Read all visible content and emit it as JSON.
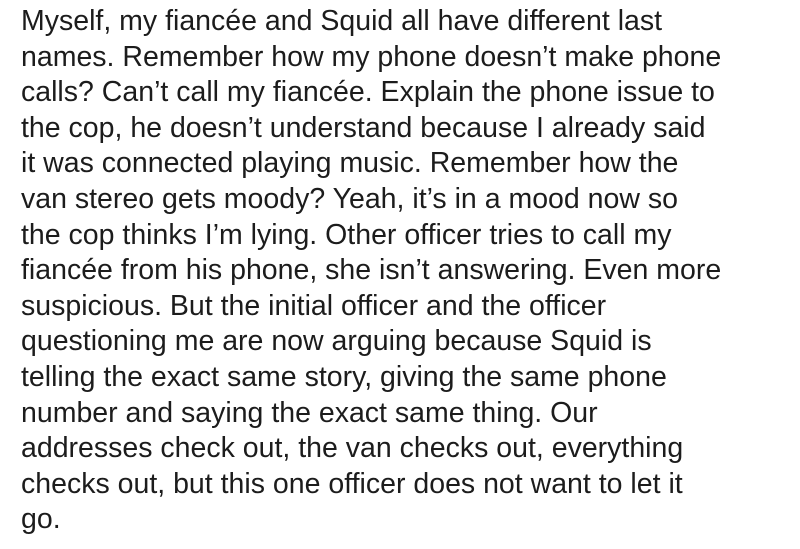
{
  "post": {
    "lines": [
      "Myself, my fiancée and Squid all have different last",
      "names. Remember how my phone doesn’t make phone",
      "calls?  Can’t call my fiancée. Explain the phone issue to",
      "the cop, he doesn’t understand because I already said",
      "it was connected playing music. Remember how the",
      "van stereo gets moody?  Yeah, it’s in a mood now so",
      "the cop thinks I’m lying.  Other officer tries to call my",
      "fiancée from his phone, she isn’t answering. Even more",
      "suspicious. But the initial officer and the officer",
      "questioning me are now arguing because Squid is",
      "telling the exact same story, giving the same phone",
      "number and saying the exact same thing. Our",
      "addresses check out, the van checks out, everything",
      "checks out, but this one officer does not want to let it",
      "go."
    ]
  },
  "colors": {
    "text": "#1c1c1c",
    "background": "#ffffff"
  }
}
